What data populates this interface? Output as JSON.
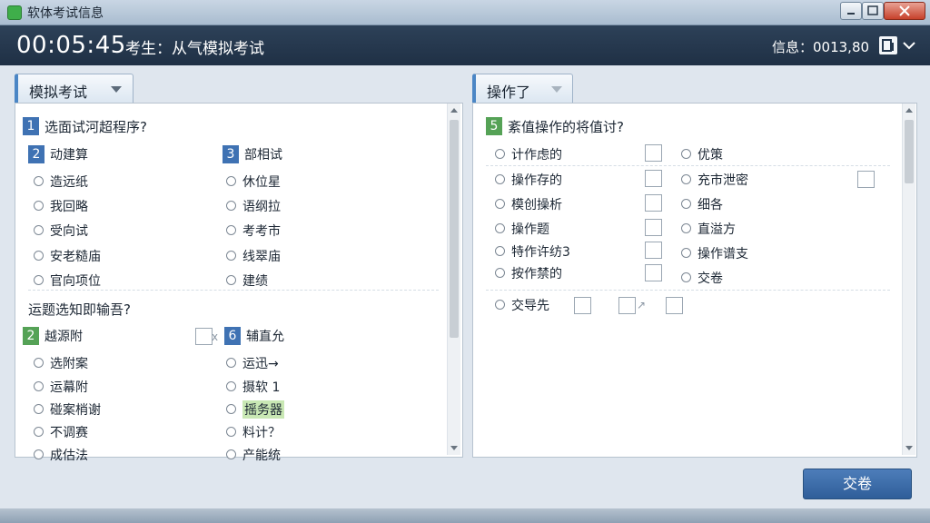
{
  "window": {
    "title": "软体考试信息"
  },
  "header": {
    "timer": "00:05:45",
    "exam_label": "考生：从气模拟考试",
    "info_text": "信息：0013,80"
  },
  "left_panel": {
    "tab_label": "模拟考试",
    "q1": {
      "num": "1",
      "text": "选面试河超程序?"
    },
    "col_a": {
      "num": "2",
      "heading": "动建算",
      "options": [
        "造远纸",
        "我回略",
        "受向试",
        "安老糙庙",
        "官向项位"
      ]
    },
    "col_b": {
      "num": "3",
      "heading": "部相试",
      "options": [
        "休位星",
        "语纲拉",
        "考考市",
        "线翠庙",
        "建绩"
      ]
    },
    "q2": {
      "text": "运题选知即输吾?"
    },
    "col_c": {
      "num": "2",
      "heading": "越源附",
      "options": [
        "选附案",
        "运幕附",
        "碰案梢谢",
        "不调赛",
        "成估法"
      ]
    },
    "col_d": {
      "num": "6",
      "heading": "辅直允",
      "options": [
        "运迅→",
        "摄软 1",
        "摇务器",
        "料计？",
        "产能统"
      ]
    }
  },
  "right_panel": {
    "tab_label": "操作了",
    "q5": {
      "num": "5",
      "text": "紊值操作的将值讨?"
    },
    "col_a": [
      "计作虑的",
      "操作存的",
      "模创操析",
      "操作题",
      "特作许纺3",
      "按作禁的"
    ],
    "col_b": [
      "优策",
      "充市泄密",
      "细各",
      "直溢方",
      "操作谱支",
      "交卷"
    ],
    "extra_option": "交导先",
    "extra_mark": "↗"
  },
  "footer": {
    "submit_label": "交卷"
  },
  "colors": {
    "header_bg": "#24374d",
    "accent_blue": "#3f72b3",
    "accent_green": "#55a256",
    "submit_bg": "#3d6cab"
  },
  "icons": [
    "app-icon",
    "minimize-icon",
    "maximize-icon",
    "close-icon",
    "info-icon",
    "chevron-down-icon"
  ]
}
